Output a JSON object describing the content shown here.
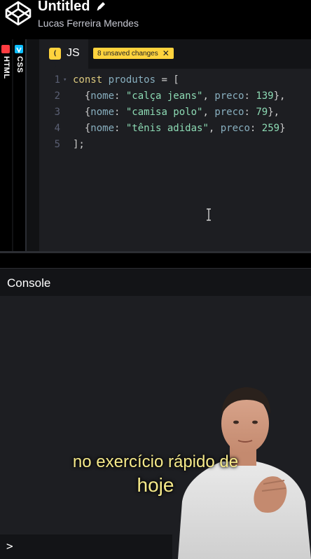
{
  "header": {
    "title": "Untitled",
    "author": "Lucas Ferreira Mendes"
  },
  "side_tabs": [
    {
      "label": "HTML",
      "color": "#ff3c41"
    },
    {
      "label": "CSS",
      "color": "#0ebeff"
    }
  ],
  "editor": {
    "tab_label": "JS",
    "tab_icon": "( )",
    "unsaved_badge": "8 unsaved changes",
    "lines": [
      {
        "n": "1",
        "fold": "▾",
        "tokens": [
          {
            "t": "const ",
            "c": "kw"
          },
          {
            "t": "produtos",
            "c": "var"
          },
          {
            "t": " = [",
            "c": "pun"
          }
        ]
      },
      {
        "n": "2",
        "fold": "",
        "tokens": [
          {
            "t": "  {",
            "c": "pun"
          },
          {
            "t": "nome",
            "c": "prop"
          },
          {
            "t": ": ",
            "c": "pun"
          },
          {
            "t": "\"calça jeans\"",
            "c": "str"
          },
          {
            "t": ", ",
            "c": "pun"
          },
          {
            "t": "preco",
            "c": "prop"
          },
          {
            "t": ": ",
            "c": "pun"
          },
          {
            "t": "139",
            "c": "num"
          },
          {
            "t": "},",
            "c": "pun"
          }
        ]
      },
      {
        "n": "3",
        "fold": "",
        "tokens": [
          {
            "t": "  {",
            "c": "pun"
          },
          {
            "t": "nome",
            "c": "prop"
          },
          {
            "t": ": ",
            "c": "pun"
          },
          {
            "t": "\"camisa polo\"",
            "c": "str"
          },
          {
            "t": ", ",
            "c": "pun"
          },
          {
            "t": "preco",
            "c": "prop"
          },
          {
            "t": ": ",
            "c": "pun"
          },
          {
            "t": "79",
            "c": "num"
          },
          {
            "t": "},",
            "c": "pun"
          }
        ]
      },
      {
        "n": "4",
        "fold": "",
        "tokens": [
          {
            "t": "  {",
            "c": "pun"
          },
          {
            "t": "nome",
            "c": "prop"
          },
          {
            "t": ": ",
            "c": "pun"
          },
          {
            "t": "\"tênis adidas\"",
            "c": "str"
          },
          {
            "t": ", ",
            "c": "pun"
          },
          {
            "t": "preco",
            "c": "prop"
          },
          {
            "t": ": ",
            "c": "pun"
          },
          {
            "t": "259",
            "c": "num"
          },
          {
            "t": "}",
            "c": "pun"
          }
        ]
      },
      {
        "n": "5",
        "fold": "",
        "tokens": [
          {
            "t": "];",
            "c": "pun"
          }
        ]
      }
    ]
  },
  "console": {
    "title": "Console",
    "prompt": ">"
  },
  "caption": {
    "line1": "no exercício rápido de",
    "line2": "hoje"
  },
  "colors": {
    "accent": "#ffd33d",
    "editor_bg": "#1d1e22"
  }
}
